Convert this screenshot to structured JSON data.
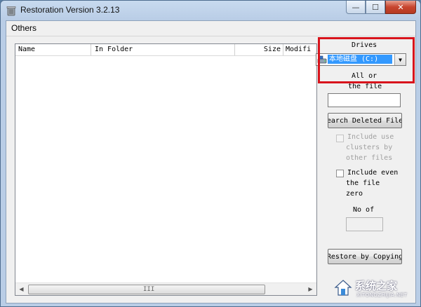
{
  "window": {
    "title": "Restoration Version 3.2.13",
    "minimize_glyph": "—",
    "maximize_glyph": "☐",
    "close_glyph": "✕"
  },
  "menu": {
    "items": [
      {
        "label": "Others"
      }
    ]
  },
  "file_list": {
    "columns": [
      "Name",
      "In Folder",
      "Size",
      "Modifi"
    ],
    "rows": [],
    "scroll_left": "◀",
    "scroll_right": "▶",
    "grip": "III"
  },
  "side_panel": {
    "drives_label": "Drives",
    "drive_selected": "本地磁盘 (C:)",
    "dropdown_glyph": "▼",
    "all_or": "All or",
    "the_file": "the file",
    "search_input_value": "",
    "search_button": "earch Deleted File",
    "include_used": {
      "line1": "Include use",
      "line2": "clusters by",
      "line3": "other files",
      "checked": false,
      "enabled": false
    },
    "include_zero": {
      "line1": "Include even",
      "line2": "the file",
      "line3": "zero",
      "checked": false,
      "enabled": true
    },
    "no_of": "No of",
    "count_value": "",
    "restore_button": "Restore by Copying"
  },
  "watermark": {
    "text": "系统之家",
    "sub": "XITONGZHIJIA.NET"
  },
  "colors": {
    "highlight": "#3399ff",
    "callout": "#d8141c"
  },
  "icons": {
    "app": "recycle-bin-icon",
    "drive": "hard-drive-icon",
    "watermark": "house-logo-icon"
  }
}
